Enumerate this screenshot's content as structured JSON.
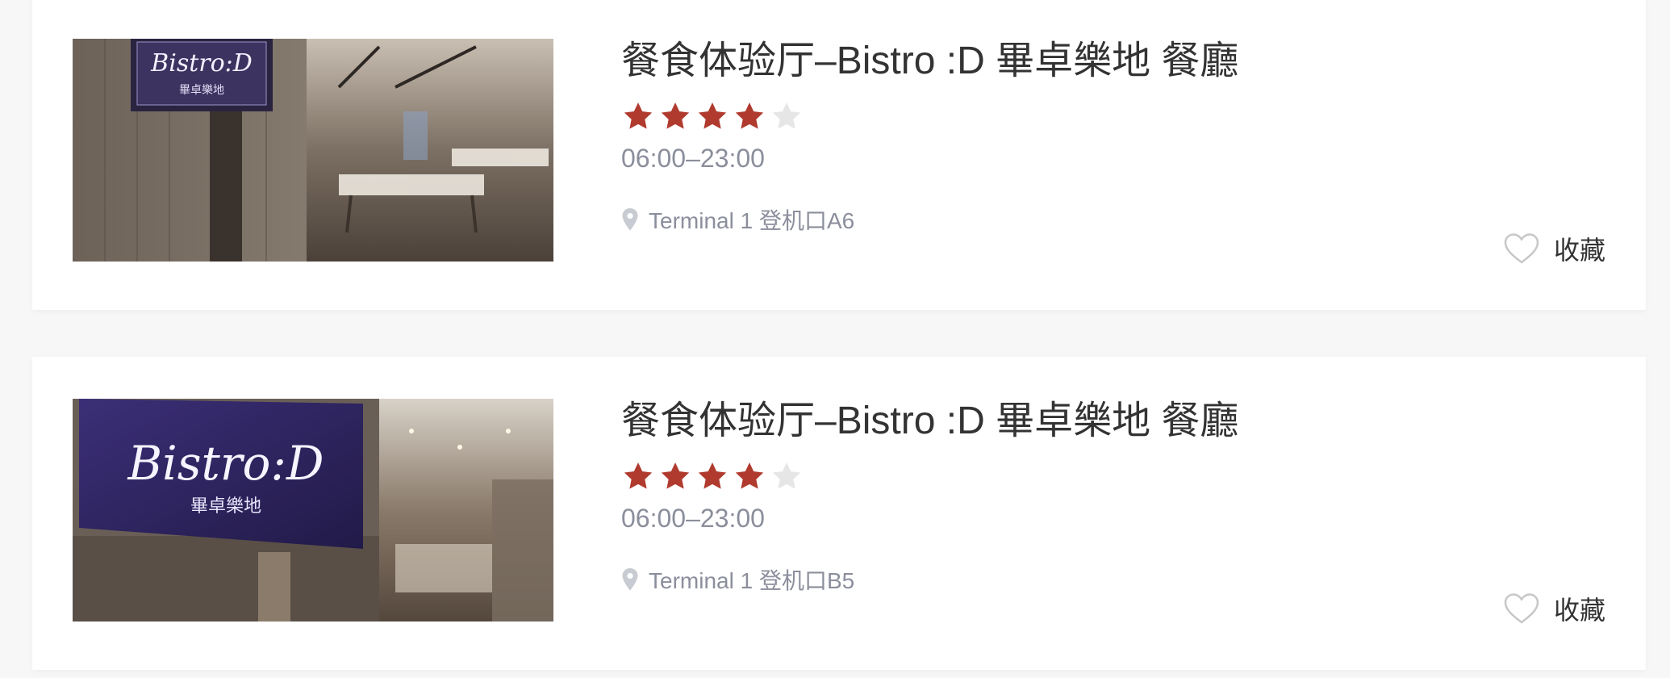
{
  "colors": {
    "star_filled": "#b03a2e",
    "star_empty": "#e6e6e6",
    "text_primary": "#333333",
    "text_secondary": "#8b8e9c",
    "heart_outline": "#c7c7c7"
  },
  "restaurants": [
    {
      "name": "餐食体验厅–Bistro :D 畢卓樂地 餐廳",
      "rating": 4,
      "rating_max": 5,
      "hours": "06:00–23:00",
      "location": "Terminal 1 登机口A6",
      "sign_text": "Bistro:D",
      "sign_subtext": "畢卓樂地",
      "favorite_label": "收藏",
      "icons": {
        "location": "map-pin-icon",
        "favorite": "heart-outline-icon",
        "star": "star-icon"
      }
    },
    {
      "name": "餐食体验厅–Bistro :D 畢卓樂地 餐廳",
      "rating": 4,
      "rating_max": 5,
      "hours": "06:00–23:00",
      "location": "Terminal 1 登机口B5",
      "sign_text": "Bistro:D",
      "sign_subtext": "畢卓樂地",
      "favorite_label": "收藏",
      "icons": {
        "location": "map-pin-icon",
        "favorite": "heart-outline-icon",
        "star": "star-icon"
      }
    }
  ]
}
